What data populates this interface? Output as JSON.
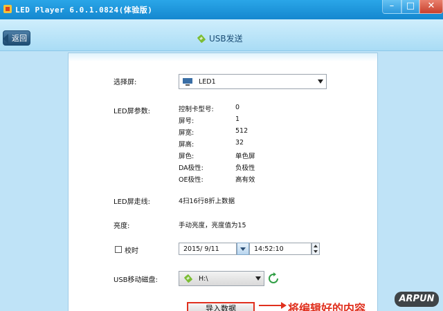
{
  "window": {
    "title": "LED Player 6.0.1.0824(体验版)",
    "minimize": "–",
    "maximize": "□",
    "close": "✕"
  },
  "header": {
    "back_label": "返回",
    "title": "USB发送"
  },
  "form": {
    "screen_select": {
      "label": "选择屏:",
      "value": "LED1"
    },
    "params": {
      "label": "LED屏参数:",
      "rows": [
        {
          "k": "控制卡型号:",
          "v": "0"
        },
        {
          "k": "屏号:",
          "v": "1"
        },
        {
          "k": "屏宽:",
          "v": "512"
        },
        {
          "k": "屏高:",
          "v": "32"
        },
        {
          "k": "屏色:",
          "v": "单色屏"
        },
        {
          "k": "DA极性:",
          "v": "负极性"
        },
        {
          "k": "OE极性:",
          "v": "高有效"
        }
      ]
    },
    "scan": {
      "label": "LED屏走线:",
      "value": "4扫16行8折上数据"
    },
    "brightness": {
      "label": "亮度:",
      "value": "手动亮度，亮度值为15"
    },
    "time_sync": {
      "label": "校时",
      "date": "2015/ 9/11",
      "time": "14:52:10"
    },
    "usb_drive": {
      "label": "USB移动磁盘:",
      "value": "H:\\"
    }
  },
  "actions": {
    "import_label": "导入数据"
  },
  "annotation": {
    "text": "将编辑好的内容"
  },
  "watermark": "ARPUN",
  "colors": {
    "titlebar": "#1487cf",
    "header": "#bfe3f7",
    "annotation_red": "#e0301e"
  }
}
